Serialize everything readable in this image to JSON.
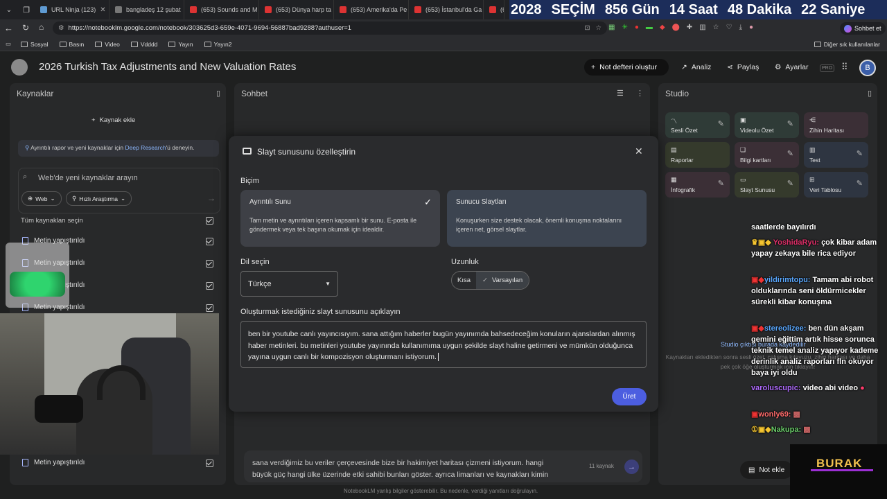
{
  "browser": {
    "tabs": [
      {
        "label": "URL Ninja (123)"
      },
      {
        "label": "bangladeş 12 şubat"
      },
      {
        "label": "(653) Sounds and M"
      },
      {
        "label": "(653) Dünya harp ta"
      },
      {
        "label": "(653) Amerika'da Pe"
      },
      {
        "label": "(653) İstanbul'da Ga"
      },
      {
        "label": "(6"
      }
    ],
    "countdown": {
      "year": "2028",
      "label": "SEÇİM",
      "days": "856 Gün",
      "hours": "14 Saat",
      "minutes": "48 Dakika",
      "seconds": "22 Saniye"
    },
    "url": "https://notebooklm.google.com/notebook/303625d3-659e-4071-9694-56887bad9288?authuser=1",
    "chat_button": "Sohbet et",
    "bookmarks": [
      "Sosyal",
      "Basın",
      "Video",
      "Vdddd",
      "Yayın",
      "Yayın2"
    ],
    "other_bookmarks": "Diğer sık kullanılanlar"
  },
  "header": {
    "title": "2026 Turkish Tax Adjustments and New Valuation Rates",
    "new_notebook": "Not defteri oluştur",
    "analysis": "Analiz",
    "share": "Paylaş",
    "settings": "Ayarlar",
    "pro_badge": "PRO",
    "avatar_letter": "B"
  },
  "sources": {
    "title": "Kaynaklar",
    "add_source": "Kaynak ekle",
    "deep_research_prefix": "Ayrıntılı rapor ve yeni kaynaklar için ",
    "deep_research_link": "Deep Research",
    "deep_research_suffix": "'ü deneyin.",
    "search_placeholder": "Web'de yeni kaynaklar arayın",
    "web_chip": "Web",
    "research_chip": "Hızlı Araştırma",
    "select_all": "Tüm kaynakları seçin",
    "items": [
      "Metin yapıştırıldı",
      "Metin yapıştırıldı",
      "Metin yapıştırıldı",
      "Metin yapıştırıldı",
      "Metin yapıştırıldı"
    ]
  },
  "chat": {
    "title": "Sohbet",
    "input_text": "sana verdiğimiz bu veriler çerçevesinde bize bir hakimiyet haritası çizmeni istiyorum. hangi büyük güç hangi ülke üzerinde etki sahibi bunları göster. ayrıca limanları ve kaynakları kimin",
    "source_count": "11 kaynak",
    "disclaimer": "NotebookLM yanlış bilgiler gösterebilir. Bu nedenle, verdiği yanıtları doğrulayın."
  },
  "studio": {
    "title": "Studio",
    "tiles": [
      {
        "label": "Sesli Özet",
        "icon": "audio-icon",
        "color": "#2f3b37"
      },
      {
        "label": "Videolu Özet",
        "icon": "video-icon",
        "color": "#2f3b37"
      },
      {
        "label": "Zihin Haritası",
        "icon": "mindmap-icon",
        "color": "#3b2f36"
      },
      {
        "label": "Raporlar",
        "icon": "report-icon",
        "color": "#353a2c"
      },
      {
        "label": "Bilgi kartları",
        "icon": "cards-icon",
        "color": "#3b2f36"
      },
      {
        "label": "Test",
        "icon": "quiz-icon",
        "color": "#2e3541"
      },
      {
        "label": "İnfografik",
        "icon": "infographic-icon",
        "color": "#3b2f36"
      },
      {
        "label": "Slayt Sunusu",
        "icon": "slides-icon",
        "color": "#353a2c"
      },
      {
        "label": "Veri Tablosu",
        "icon": "table-icon",
        "color": "#2e3541"
      }
    ],
    "empty_title": "Studio çıktısı burada kaydedilir",
    "empty_desc": "Kaynakları ekledikten sonra sesli özet, çalışma kılavuzu, zihin haritası ve daha pek çok öğe oluşturmak için tıklayın!",
    "add_note": "Not ekle"
  },
  "modal": {
    "title": "Slayt sunusunu özelleştirin",
    "format_label": "Biçim",
    "format_options": [
      {
        "title": "Ayrıntılı Sunu",
        "desc": "Tam metin ve ayrıntıları içeren kapsamlı bir sunu. E-posta ile göndermek veya tek başına okumak için idealdir.",
        "selected": true
      },
      {
        "title": "Sunucu Slaytları",
        "desc": "Konuşurken size destek olacak, önemli konuşma noktalarını içeren net, görsel slaytlar.",
        "selected": false
      }
    ],
    "language_label": "Dil seçin",
    "language_value": "Türkçe",
    "length_label": "Uzunluk",
    "length_options": [
      "Kısa",
      "Varsayılan"
    ],
    "length_selected": "Varsayılan",
    "description_label": "Oluşturmak istediğiniz slayt sunusunu açıklayın",
    "description_value": "ben bir youtube canlı yayıncısıyım. sana attığım haberler bugün yayınımda bahsedeceğim konuların ajanslardan alınmış haber metinleri. bu metinleri youtube yayınında kullanımıma uygun şekilde slayt haline getirmeni ve mümkün olduğunca yayına uygun canlı bir kompozisyon oluşturmanı istiyorum.",
    "generate_button": "Üret"
  },
  "stream_chat": [
    {
      "user": "",
      "text": "saatlerde bayılırdı",
      "color": "#ffffff"
    },
    {
      "user": "YoshidaRyu:",
      "text": "çok kibar adam yapay zekaya bile rica ediyor",
      "color": "#e0306a"
    },
    {
      "user": "yildirimtopu:",
      "text": "Tamam abi robot olduklarında seni öldürmicekler sürekli kibar konuşma",
      "color": "#5aa8ff"
    },
    {
      "user": "stereolizee:",
      "text": "ben dün akşam gemini eğittim artık hisse sorunca teknik temel analiz yapıyor kademe derinlik analiz raporları fln okuyor baya iyi oldu",
      "color": "#5aa8ff"
    },
    {
      "user": "varoluscupic:",
      "text": "video abi video",
      "color": "#b06bff"
    },
    {
      "user": "wonly69:",
      "text": "",
      "color": "#ff6b6b"
    },
    {
      "user": "Nakupa:",
      "text": "",
      "color": "#6bcf6b"
    }
  ],
  "overlay_logo": "BURAK"
}
